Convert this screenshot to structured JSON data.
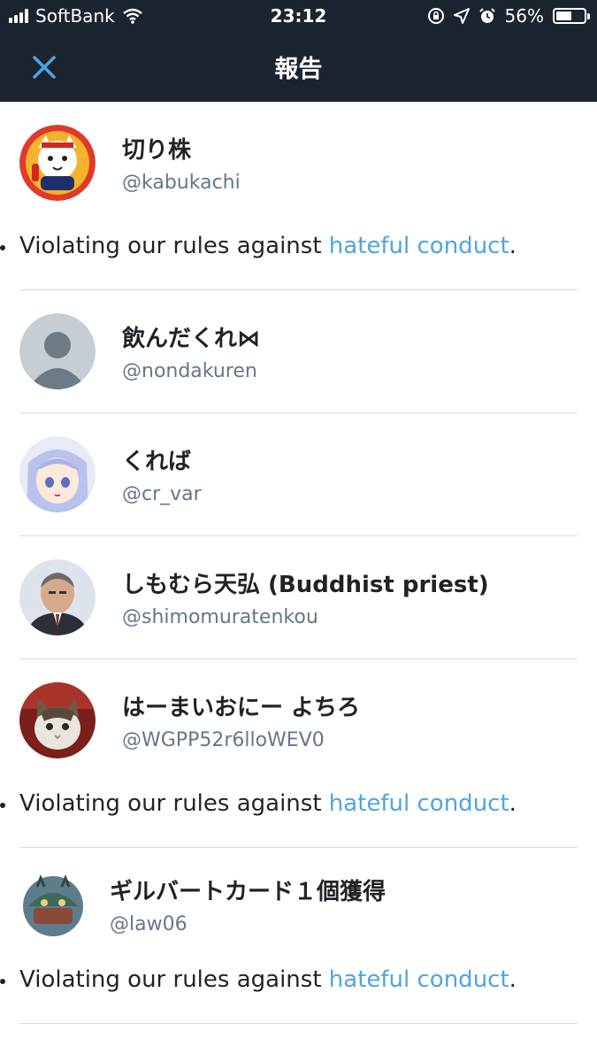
{
  "status_bar": {
    "carrier": "SoftBank",
    "time": "23:12",
    "battery_percent": "56%",
    "battery_level": 0.56
  },
  "header": {
    "title": "報告"
  },
  "reason": {
    "prefix": "Violating our rules against ",
    "link": "hateful conduct",
    "suffix": "."
  },
  "accounts": [
    {
      "name": "切り株",
      "handle": "@kabukachi"
    },
    {
      "name": "飲んだくれ⋈",
      "handle": "@nondakuren"
    },
    {
      "name": "くれば",
      "handle": "@cr_var"
    },
    {
      "name": "しもむら天弘 (Buddhist priest)",
      "handle": "@shimomuratenkou"
    },
    {
      "name": "はーまいおにー よちろ",
      "handle": "@WGPP52r6lloWEV0"
    },
    {
      "name": "ギルバートカード１個獲得",
      "handle": "@law06"
    }
  ],
  "colors": {
    "header_bg": "#1c2430",
    "accent": "#4ea4e2",
    "secondary_text": "#657786"
  }
}
